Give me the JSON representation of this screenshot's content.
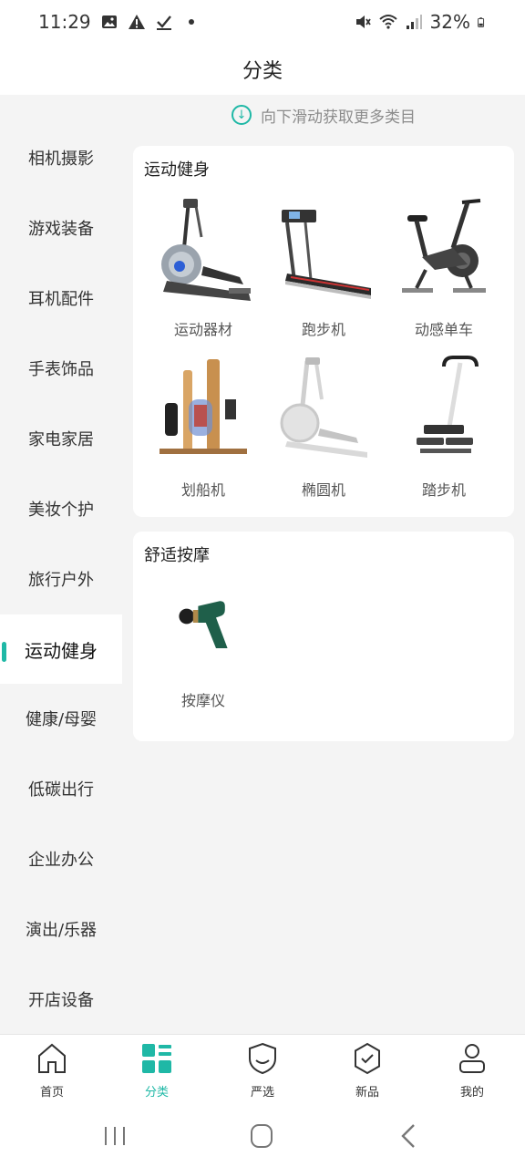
{
  "status_bar": {
    "time": "11:29",
    "battery": "32%",
    "icons": [
      "image-icon",
      "alert-icon",
      "check-icon",
      "dot-icon",
      "mute-icon",
      "wifi-icon",
      "signal-icon",
      "battery-icon"
    ]
  },
  "header": {
    "title": "分类"
  },
  "sidebar": {
    "items": [
      {
        "label": "相机摄影"
      },
      {
        "label": "游戏装备"
      },
      {
        "label": "耳机配件"
      },
      {
        "label": "手表饰品"
      },
      {
        "label": "家电家居"
      },
      {
        "label": "美妆个护"
      },
      {
        "label": "旅行户外"
      },
      {
        "label": "运动健身"
      },
      {
        "label": "健康/母婴"
      },
      {
        "label": "低碳出行"
      },
      {
        "label": "企业办公"
      },
      {
        "label": "演出/乐器"
      },
      {
        "label": "开店设备"
      }
    ],
    "active_label": "运动健身"
  },
  "main": {
    "hint": "向下滑动获取更多类目",
    "sections": [
      {
        "title": "运动健身",
        "products": [
          {
            "label": "运动器材",
            "icon": "elliptical-machine-image"
          },
          {
            "label": "跑步机",
            "icon": "treadmill-image"
          },
          {
            "label": "动感单车",
            "icon": "spin-bike-image"
          },
          {
            "label": "划船机",
            "icon": "rowing-machine-image"
          },
          {
            "label": "椭圆机",
            "icon": "white-elliptical-image"
          },
          {
            "label": "踏步机",
            "icon": "stepper-image"
          }
        ]
      },
      {
        "title": "舒适按摩",
        "products": [
          {
            "label": "按摩仪",
            "icon": "massage-gun-image"
          }
        ]
      }
    ]
  },
  "bottom_nav": {
    "items": [
      {
        "label": "首页",
        "icon": "home-icon"
      },
      {
        "label": "分类",
        "icon": "category-icon"
      },
      {
        "label": "严选",
        "icon": "shield-icon"
      },
      {
        "label": "新品",
        "icon": "new-badge-icon"
      },
      {
        "label": "我的",
        "icon": "profile-icon"
      }
    ],
    "active_label": "分类"
  },
  "colors": {
    "accent": "#1fb8a6",
    "background": "#f4f4f4",
    "card": "#ffffff"
  }
}
